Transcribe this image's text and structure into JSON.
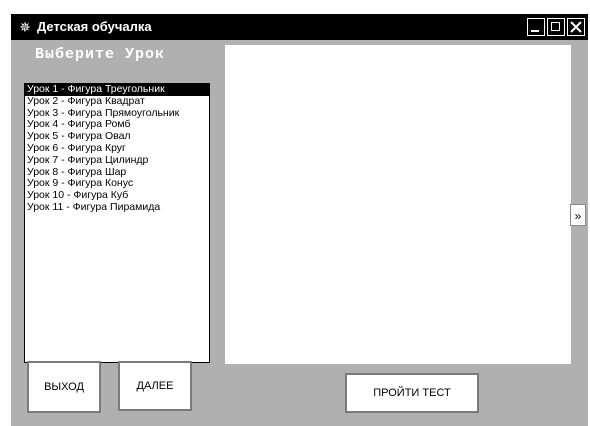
{
  "window": {
    "title": "Детская обучалка",
    "icon": "gear-icon"
  },
  "lessons_panel": {
    "heading": "Выберите Урок",
    "items": [
      "Урок 1 - Фигура Треугольник",
      "Урок 2 - Фигура Квадрат",
      "Урок 3 - Фигура Прямоугольник",
      "Урок 4 - Фигура Ромб",
      "Урок 5 - Фигура Овал",
      "Урок 6 - Фигура Круг",
      "Урок 7 - Фигура Цилиндр",
      "Урок 8 - Фигура Шар",
      "Урок 9 - Фигура Конус",
      "Урок 10 - Фигура Куб",
      "Урок 11 - Фигура Пирамида"
    ],
    "selected_index": 0
  },
  "buttons": {
    "exit": "ВЫХОД",
    "next": "ДАЛЕЕ",
    "test": "ПРОЙТИ ТЕСТ",
    "forward_arrow": "»"
  }
}
